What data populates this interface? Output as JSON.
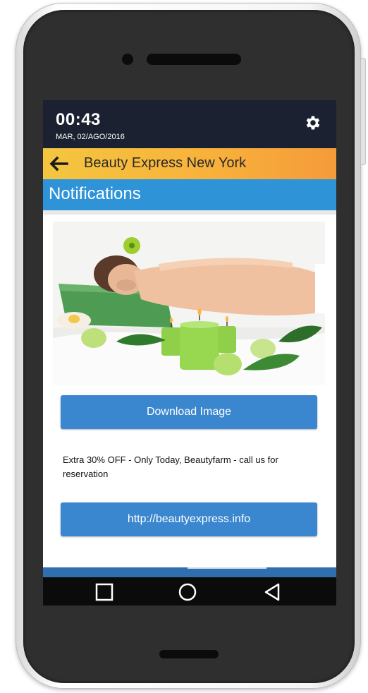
{
  "status_bar": {
    "time": "00:43",
    "date": "MAR, 02/AGO/2016",
    "settings_icon": "gear-icon"
  },
  "app_bar": {
    "back_icon": "arrow-left-icon",
    "title": "Beauty Express New York"
  },
  "section": {
    "title": "Notifications"
  },
  "notification": {
    "image_subject": "spa-massage-photo",
    "download_button": "Download Image",
    "message": "Extra 30% OFF - Only Today, Beautyfarm - call us for reservation",
    "link_button": "http://beautyexpress.info"
  },
  "nav_bar": {
    "recents_icon": "square-icon",
    "home_icon": "circle-icon",
    "back_icon": "triangle-back-icon"
  },
  "colors": {
    "status_bar": "#1b2130",
    "app_bar_start": "#f4c640",
    "app_bar_end": "#f59b3a",
    "section_bar": "#2f93d7",
    "button": "#3a87cf"
  }
}
